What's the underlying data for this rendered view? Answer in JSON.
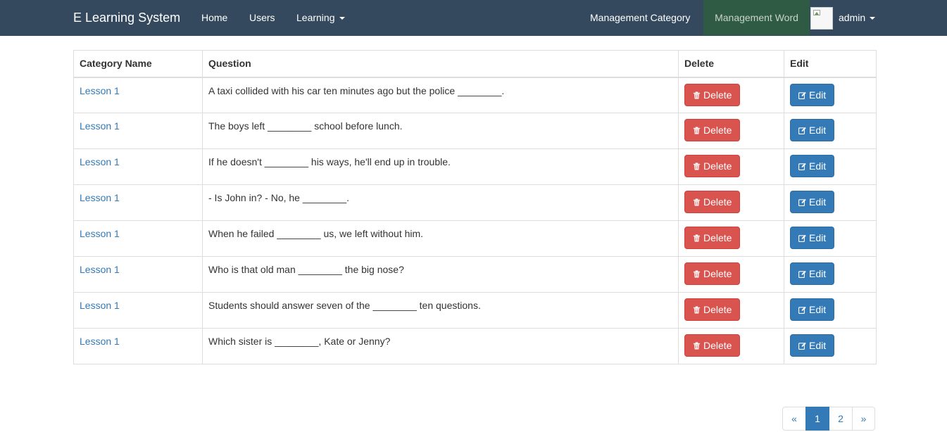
{
  "navbar": {
    "brand": "E Learning System",
    "home": "Home",
    "users": "Users",
    "learning": "Learning",
    "management_category": "Management Category",
    "management_word": "Management Word",
    "user": "admin"
  },
  "table": {
    "headers": [
      "Category Name",
      "Question",
      "Delete",
      "Edit"
    ],
    "delete_label": "Delete",
    "edit_label": "Edit",
    "rows": [
      {
        "category": "Lesson 1",
        "question": "A taxi collided with his car ten minutes ago but the police ________."
      },
      {
        "category": "Lesson 1",
        "question": "The boys left ________ school before lunch."
      },
      {
        "category": "Lesson 1",
        "question": "If he doesn't ________ his ways, he'll end up in trouble."
      },
      {
        "category": "Lesson 1",
        "question": "- Is John in? - No, he ________."
      },
      {
        "category": "Lesson 1",
        "question": "When he failed ________ us, we left without him."
      },
      {
        "category": "Lesson 1",
        "question": "Who is that old man ________ the big nose?"
      },
      {
        "category": "Lesson 1",
        "question": "Students should answer seven of the ________ ten questions."
      },
      {
        "category": "Lesson 1",
        "question": "Which sister is ________, Kate or Jenny?"
      }
    ]
  },
  "pagination": {
    "prev": "«",
    "pages": [
      "1",
      "2"
    ],
    "active_page": "1",
    "next": "»"
  },
  "icons": {
    "delete": "trash-icon",
    "edit": "edit-icon"
  },
  "colors": {
    "navbar": "#34495e",
    "active_nav": "#2f5a43",
    "danger": "#d9534f",
    "primary": "#337ab7",
    "link": "#337ab7"
  }
}
